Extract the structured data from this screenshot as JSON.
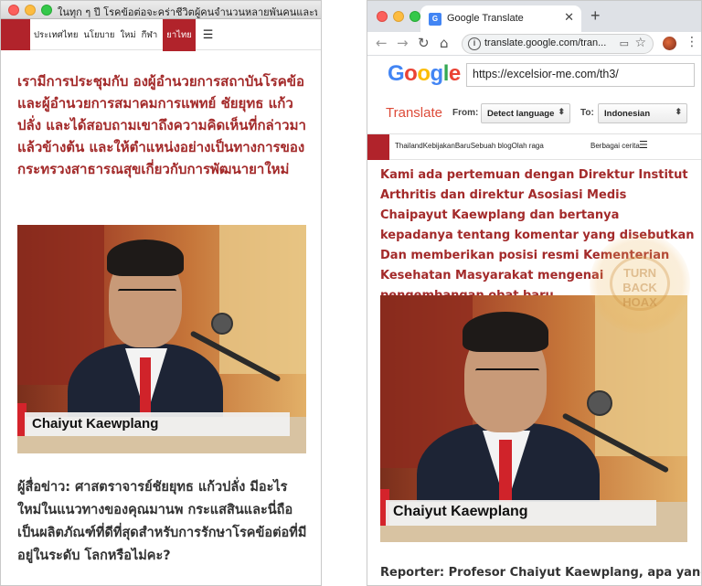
{
  "left_window": {
    "title": "ในทุก ๆ ปี โรคข้อต่อจะคร่าชีวิตผู้คนจำนวนหลายพันคนและทำให้ผู้ป่วย...",
    "nav": {
      "items": [
        "ประเทศไทย",
        "นโยบาย",
        "ใหม่",
        "กีฬา"
      ],
      "active_item": "ยาไทย"
    },
    "headline": "เรามีการประชุมกับ องผู้อำนวยการสถาบันโรคข้อและผู้อำนวยการสมาคมการแพทย์ ชัยยุทธ แก้วปลั่ง และได้สอบถามเขาถึงความคิดเห็นที่กล่าวมาแล้วข้างต้น และให้ตำแหน่งอย่างเป็นทางการของกระทรวงสาธารณสุขเกี่ยวกับการพัฒนายาใหม่",
    "photo_caption": "Chaiyut Kaewplang",
    "reporter_text": "ผู้สื่อข่าว: ศาสตราจารย์ชัยยุทธ แก้วปลั่ง มีอะไรใหม่ในแนวทางของคุณมานพ กระแสสินและนี่ถือเป็นผลิตภัณฑ์ที่ดีที่สุดสำหรับการรักษาโรคข้อต่อที่มีอยู่ในระดับ โลกหรือไม่คะ?"
  },
  "right_window": {
    "tab": {
      "title": "Google Translate",
      "favicon_label": "G"
    },
    "url": "translate.google.com/tran...",
    "gt": {
      "logo": [
        "G",
        "o",
        "o",
        "g",
        "l",
        "e"
      ],
      "logo_colors": [
        "#4285f4",
        "#ea4335",
        "#fbbc05",
        "#4285f4",
        "#34a853",
        "#ea4335"
      ],
      "url_input_value": "https://excelsior-me.com/th3/",
      "title": "Translate",
      "from_label": "From:",
      "from_value": "Detect language",
      "to_label": "To:",
      "to_value": "Indonesian"
    },
    "site_nav": {
      "items_text": "ThailandKebijakanBaruSebuah blogOlah raga",
      "extra": "Berbagai cerita"
    },
    "headline": "Kami ada pertemuan dengan Direktur Institut Arthritis dan direktur Asosiasi Medis Chaipayut Kaewplang dan bertanya kepadanya tentang komentar yang disebutkan Dan memberikan posisi resmi Kementerian Kesehatan Masyarakat mengenai pengembangan obat baru",
    "photo_caption": "Chaiyut Kaewplang",
    "reporter_text": "Reporter: Profesor Chaiyut Kaewplang, apa yang"
  },
  "watermark": {
    "seal_text": "TURN BACK HOAX",
    "seal_lines": [
      "TURN",
      "BACK",
      "HOAX"
    ]
  },
  "colors": {
    "accent_red": "#b1232b",
    "headline_red": "#a32a2a",
    "translate_red": "#dd4b39"
  }
}
